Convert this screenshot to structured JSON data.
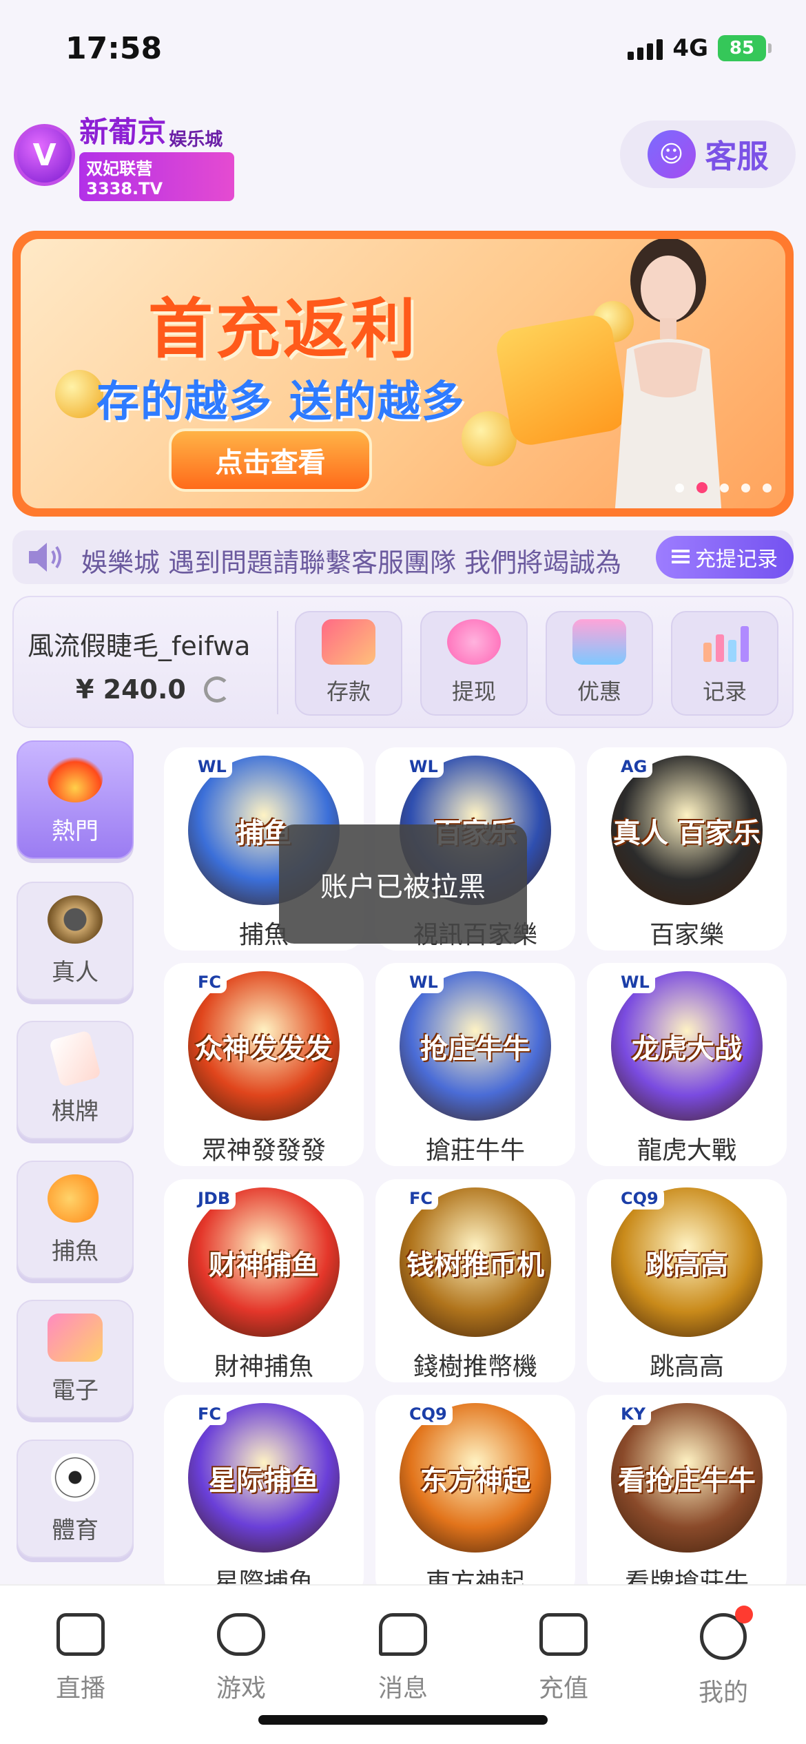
{
  "status_bar": {
    "time": "17:58",
    "network": "4G",
    "battery": "85"
  },
  "header": {
    "logo_name": "新葡京",
    "logo_suffix": "娱乐城",
    "logo_tagline": "双妃联营3338.TV",
    "customer_service_label": "客服"
  },
  "banner": {
    "title": "首充返利",
    "subtitle": "存的越多  送的越多",
    "button_label": "点击查看",
    "page_count": 5,
    "active_page": 2
  },
  "notice": {
    "text": "娛樂城  遇到問題請聯繫客服團隊 我們將竭誠為",
    "record_button": "充提记录"
  },
  "account": {
    "username": "風流假睫毛_feifwa",
    "balance": "¥ 240.0",
    "actions": [
      {
        "label": "存款",
        "icon": "card-icon",
        "color": "#ff8aa0"
      },
      {
        "label": "提现",
        "icon": "money-bag-icon",
        "color": "#ff9ad1"
      },
      {
        "label": "优惠",
        "icon": "gift-icon",
        "color": "#7ec8ff"
      },
      {
        "label": "记录",
        "icon": "bar-chart-icon",
        "color": "#ffb08a"
      }
    ]
  },
  "categories": [
    {
      "label": "熱門",
      "icon": "fire-icon",
      "active": true
    },
    {
      "label": "真人",
      "icon": "poker-chip-icon",
      "active": false
    },
    {
      "label": "棋牌",
      "icon": "playing-card-icon",
      "active": false
    },
    {
      "label": "捕魚",
      "icon": "shark-icon",
      "active": false
    },
    {
      "label": "電子",
      "icon": "slot-machine-icon",
      "active": false
    },
    {
      "label": "體育",
      "icon": "soccer-ball-icon",
      "active": false
    }
  ],
  "games": [
    {
      "label": "捕魚",
      "badge": "WL",
      "art_text": "捕鱼",
      "color": "#3b6fd9"
    },
    {
      "label": "視訊百家樂",
      "badge": "WL",
      "art_text": "百家乐",
      "color": "#2f4fb0"
    },
    {
      "label": "百家樂",
      "badge": "AG",
      "art_text": "真人 百家乐",
      "color": "#2b2b2b"
    },
    {
      "label": "眾神發發發",
      "badge": "FC",
      "art_text": "众神发发发",
      "color": "#e0451c"
    },
    {
      "label": "搶莊牛牛",
      "badge": "WL",
      "art_text": "抢庄牛牛",
      "color": "#4a6cd6"
    },
    {
      "label": "龍虎大戰",
      "badge": "WL",
      "art_text": "龙虎大战",
      "color": "#7a4be0"
    },
    {
      "label": "財神捕魚",
      "badge": "JDB",
      "art_text": "财神捕鱼",
      "color": "#e4362a"
    },
    {
      "label": "錢樹推幣機",
      "badge": "FC",
      "art_text": "钱树推币机",
      "color": "#b0741c"
    },
    {
      "label": "跳高高",
      "badge": "CQ9",
      "art_text": "跳高高",
      "color": "#c98a1a"
    },
    {
      "label": "星際捕魚",
      "badge": "FC",
      "art_text": "星际捕鱼",
      "color": "#6a3fd8"
    },
    {
      "label": "東方神起",
      "badge": "CQ9",
      "art_text": "东方神起",
      "color": "#e2741b"
    },
    {
      "label": "看牌搶莊牛",
      "badge": "KY",
      "art_text": "看抢庄牛牛",
      "color": "#8a4a2a"
    }
  ],
  "toast": "账户已被拉黑",
  "tabbar": [
    {
      "label": "直播",
      "icon": "video-camera-icon"
    },
    {
      "label": "游戏",
      "icon": "gamepad-icon"
    },
    {
      "label": "消息",
      "icon": "message-icon"
    },
    {
      "label": "充值",
      "icon": "wallet-icon"
    },
    {
      "label": "我的",
      "icon": "profile-icon"
    }
  ]
}
